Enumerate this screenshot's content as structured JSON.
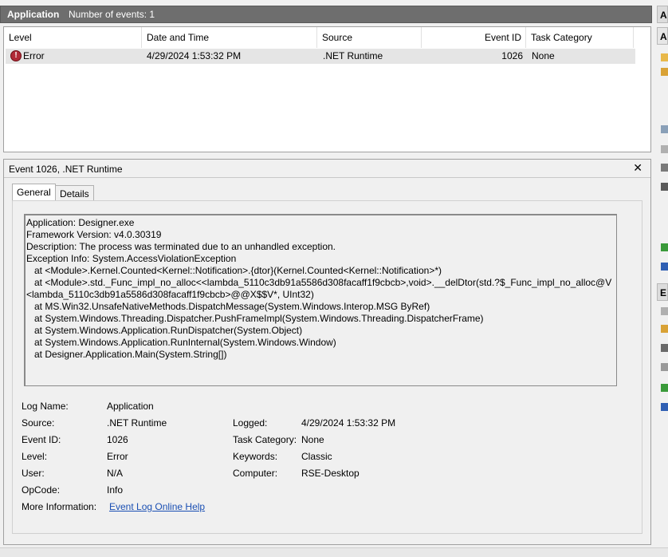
{
  "header": {
    "log_name": "Application",
    "event_count": "Number of events: 1"
  },
  "columns": [
    "Level",
    "Date and Time",
    "Source",
    "Event ID",
    "Task Category"
  ],
  "events": [
    {
      "level": "Error",
      "datetime": "4/29/2024 1:53:32 PM",
      "source": ".NET Runtime",
      "event_id": "1026",
      "category": "None"
    }
  ],
  "detail": {
    "title": "Event 1026, .NET Runtime",
    "close": "✕",
    "tabs": [
      "General",
      "Details"
    ],
    "description_lines": [
      "Application: Designer.exe",
      "Framework Version: v4.0.30319",
      "Description: The process was terminated due to an unhandled exception.",
      "Exception Info: System.AccessViolationException",
      "   at <Module>.Kernel.Counted<Kernel::Notification>.{dtor}(Kernel.Counted<Kernel::Notification>*)",
      "   at <Module>.std._Func_impl_no_alloc<<lambda_5110c3db91a5586d308facaff1f9cbcb>,void>.__delDtor(std.?$_Func_impl_no_alloc@V",
      "<lambda_5110c3db91a5586d308facaff1f9cbcb>@@X$$V*, UInt32)",
      "   at MS.Win32.UnsafeNativeMethods.DispatchMessage(System.Windows.Interop.MSG ByRef)",
      "   at System.Windows.Threading.Dispatcher.PushFrameImpl(System.Windows.Threading.DispatcherFrame)",
      "   at System.Windows.Application.RunDispatcher(System.Object)",
      "   at System.Windows.Application.RunInternal(System.Windows.Window)",
      "   at Designer.Application.Main(System.String[])"
    ],
    "fields": {
      "log_name_label": "Log Name:",
      "log_name": "Application",
      "source_label": "Source:",
      "source": ".NET Runtime",
      "logged_label": "Logged:",
      "logged": "4/29/2024 1:53:32 PM",
      "event_id_label": "Event ID:",
      "event_id": "1026",
      "task_category_label": "Task Category:",
      "task_category": "None",
      "level_label": "Level:",
      "level": "Error",
      "keywords_label": "Keywords:",
      "keywords": "Classic",
      "user_label": "User:",
      "user": "N/A",
      "computer_label": "Computer:",
      "computer": "RSE-Desktop",
      "opcode_label": "OpCode:",
      "opcode": "Info",
      "more_info_label": "More Information:",
      "more_info_link": "Event Log Online Help"
    }
  },
  "actions_pane": {
    "header1": "A",
    "header2": "A",
    "header3": "E"
  }
}
